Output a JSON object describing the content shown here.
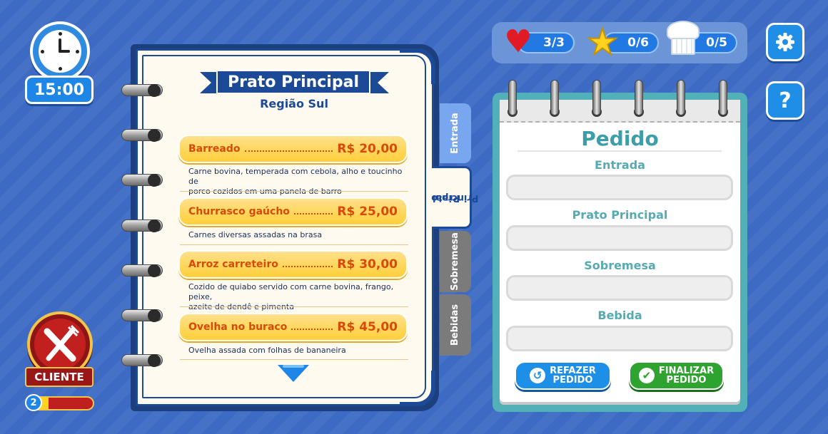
{
  "timer": {
    "value": "15:00"
  },
  "menu": {
    "title": "Prato Principal",
    "region": "Região Sul",
    "dishes": [
      {
        "name": "Barreado",
        "price": "R$ 20,00",
        "desc_l1": "Carne bovina, temperada com cebola, alho e toucinho de",
        "desc_l2": "porco cozidos em uma panela de barro"
      },
      {
        "name": "Churrasco gaúcho",
        "price": "R$ 25,00",
        "desc_l1": "Carnes diversas assadas na brasa",
        "desc_l2": ""
      },
      {
        "name": "Arroz carreteiro",
        "price": "R$ 30,00",
        "desc_l1": "Cozido de quiabo servido com carne bovina, frango, peixe,",
        "desc_l2": "azeite de dendê e pimenta"
      },
      {
        "name": "Ovelha no buraco",
        "price": "R$ 45,00",
        "desc_l1": "Ovelha assada com folhas de bananeira",
        "desc_l2": ""
      }
    ],
    "tabs": {
      "entrada": "Entrada",
      "prato_l1": "Prato",
      "prato_l2": "Principal",
      "sobremesa": "Sobremesa",
      "bebidas": "Bebidas"
    }
  },
  "stats": {
    "lives": "3/3",
    "stars": "0/6",
    "chef": "0/5"
  },
  "order": {
    "title": "Pedido",
    "labels": {
      "entrada": "Entrada",
      "prato": "Prato Principal",
      "sobremesa": "Sobremesa",
      "bebida": "Bebida"
    },
    "redo_l1": "REFAZER",
    "redo_l2": "PEDIDO",
    "finish_l1": "FINALIZAR",
    "finish_l2": "PEDIDO"
  },
  "client": {
    "label": "CLIENTE",
    "level": "2",
    "progress": 0.3
  },
  "colors": {
    "background": "#3d6bc4",
    "accent_blue": "#1e86e6",
    "dish_yellow": "#ffcf3a",
    "price_orange": "#d94a0a",
    "pad_teal": "#3e9ea8"
  },
  "icons": [
    "clock-icon",
    "heart-icon",
    "star-icon",
    "chef-hat-icon",
    "gear-icon",
    "question-icon",
    "fork-knife-icon",
    "refresh-icon",
    "check-icon",
    "down-arrow-icon"
  ]
}
